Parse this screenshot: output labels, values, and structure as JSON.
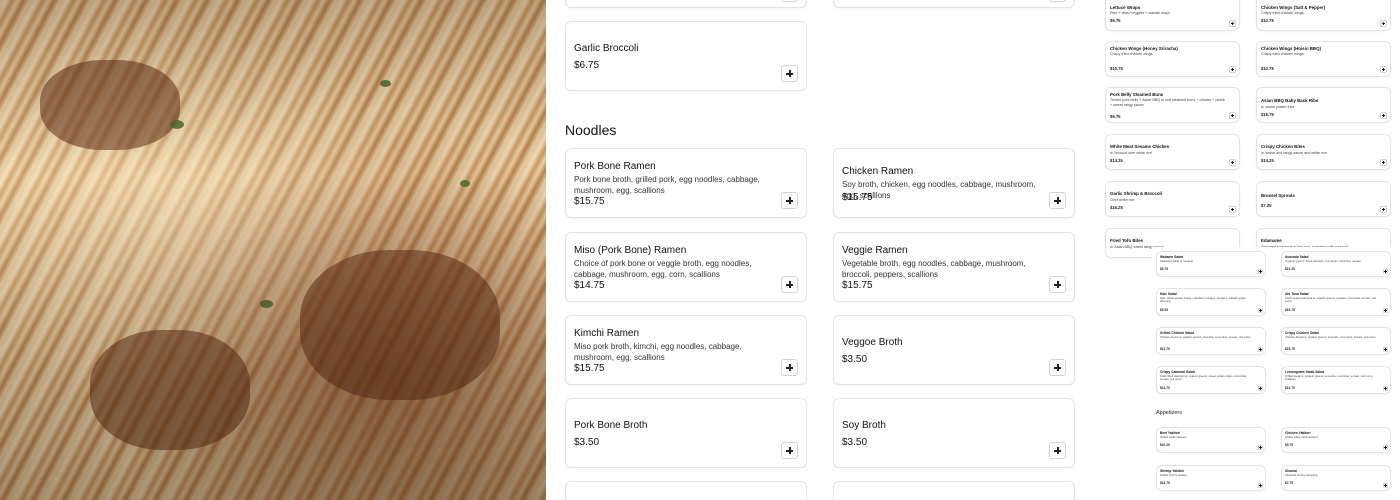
{
  "photo": {
    "alt": ""
  },
  "left_column": {
    "garlic_broccoli": {
      "name": "Garlic Broccoli",
      "price": "$6.75"
    },
    "noodles_title": "Noodles",
    "items": [
      {
        "name": "Pork Bone Ramen",
        "desc": "Pork bone broth, grilled pork, egg noodles, cabbage, mushroom, egg, scallions",
        "price": "$15.75"
      },
      {
        "name": "Miso (Pork Bone) Ramen",
        "desc": "Choice of pork bone or veggie broth, egg noodles, cabbage, mushroom, egg, corn, scallions",
        "price": "$14.75"
      },
      {
        "name": "Kimchi Ramen",
        "desc": "Miso pork broth, kimchi, egg noodles, cabbage, mushroom, egg, scallions",
        "price": "$15.75"
      },
      {
        "name": "Pork Bone Broth",
        "desc": "",
        "price": "$3.50"
      }
    ]
  },
  "right_column": {
    "items": [
      {
        "name": "Chicken Ramen",
        "desc": "Soy broth, chicken, egg noodles, cabbage, mushroom, egg, scallions",
        "price": "$15.75"
      },
      {
        "name": "Veggie Ramen",
        "desc": "Vegetable broth, egg noodles, cabbage, mushroom, broccoli, peppers, scallions",
        "price": "$15.75"
      },
      {
        "name": "Veggoe Broth",
        "desc": "",
        "price": "$3.50"
      },
      {
        "name": "Soy Broth",
        "desc": "",
        "price": "$3.50"
      }
    ]
  },
  "side_menu": {
    "items": [
      {
        "name": "Lettuce Wraps",
        "desc": "Rice + diced veggies + wasabi mayo",
        "price": "$9.75"
      },
      {
        "name": "Chicken Wings (Salt & Pepper)",
        "desc": "Crispy fried chicken wings.",
        "price": "$10.75"
      },
      {
        "name": "Chicken Wings (Honey Sriracha)",
        "desc": "Crispy fried chicken wings.",
        "price": "$10.75"
      },
      {
        "name": "Chicken Wings (Hoisin BBQ)",
        "desc": "Crispy fried chicken wings.",
        "price": "$10.75"
      },
      {
        "name": "Pork Belly Steamed Buns",
        "desc": "Tender pork belly + Asian BBQ in soft steamed buns + cilantro + pickle + sweet tangy sauce",
        "price": "$9.75"
      },
      {
        "name": "Asian BBQ Baby Back Ribs",
        "desc": "w. sweet potato fries",
        "price": "$15.75"
      },
      {
        "name": "White Meat Sesame Chicken",
        "desc": "w. broccoli over white rice",
        "price": "$14.25"
      },
      {
        "name": "Crispy Chicken Bites",
        "desc": "w. sweet and tangy sauce and white rice",
        "price": "$14.25"
      },
      {
        "name": "Garlic Shrimp & Broccoli",
        "desc": "Over white rice",
        "price": "$16.25"
      },
      {
        "name": "Brussel Sprouts",
        "desc": "",
        "price": "$7.25"
      },
      {
        "name": "Fried Tofu Bites",
        "desc": "w. Asian BBQ sweet tangy sauce",
        "price": ""
      },
      {
        "name": "Edamame",
        "desc": "Steamed soybeans in the pod, sprinkled with sea salt",
        "price": ""
      }
    ],
    "salads": [
      {
        "name": "Wakame Salad",
        "desc": "Seaweed salad w. sesame",
        "price": "$5.75"
      },
      {
        "name": "Avocado Salad",
        "desc": "Organic greens, diced avocado, red onion, cucumber, tomato",
        "price": "$13.25"
      },
      {
        "name": "Kale Salad",
        "desc": "Kale, sweet potato crisps, mandarin oranges, tossed in wasabi ginger dressing",
        "price": "$9.25"
      },
      {
        "name": "Ahi Tuna Salad",
        "desc": "Fresh seared ahi tuna w. organic greens, peppers, cucumber, tomato, red onion",
        "price": "$15.75"
      },
      {
        "name": "Grilled Chicken Salad",
        "desc": "Chicken breast w. organic greens, avocado, cucumber, tomato, red onion",
        "price": "$13.75"
      },
      {
        "name": "Crispy Chicken Salad",
        "desc": "Chicken breast w. organic greens, avocado, cucumber, tomato, red onion",
        "price": "$15.75"
      },
      {
        "name": "Crispy Calamari Salad",
        "desc": "Flash fried calamari w. organic greens, sweet potato crisps, cucumber, tomato, red onion",
        "price": "$13.75"
      },
      {
        "name": "Lemongrass Steak Salad",
        "desc": "Grilled steak w. organic greens, avocado, cucumber, tomato, red onion, scallions",
        "price": "$14.75"
      }
    ],
    "appetizers_title": "Appetizers",
    "appetizers": [
      {
        "name": "Beef Yakitori",
        "desc": "Grilled steak skewers",
        "price": "$10.25"
      },
      {
        "name": "Chicken Yakitori",
        "desc": "Grilled white meat skewers",
        "price": "$9.75"
      },
      {
        "name": "Shrimp Yakitori",
        "desc": "Grilled shrimp skewer",
        "price": "$13.75"
      },
      {
        "name": "Shumai",
        "desc": "Steamed shrimp dumpling",
        "price": "$7.75"
      }
    ]
  }
}
